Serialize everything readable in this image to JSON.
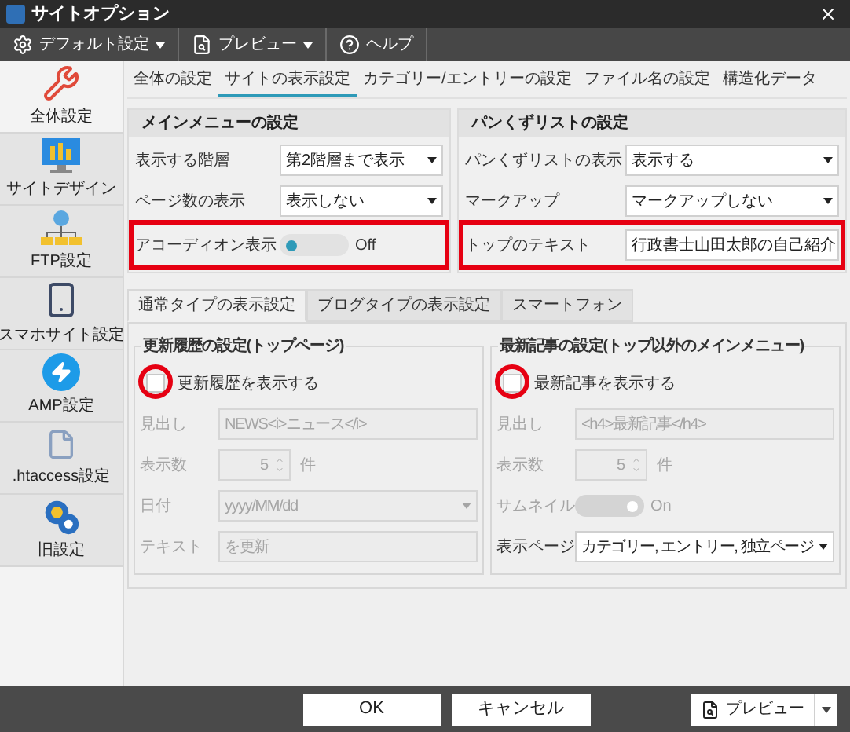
{
  "window": {
    "title": "サイトオプション"
  },
  "toolbar": [
    {
      "label": "デフォルト設定",
      "dropdown": true
    },
    {
      "label": "プレビュー",
      "dropdown": true
    },
    {
      "label": "ヘルプ",
      "dropdown": false
    }
  ],
  "sidebar": [
    {
      "label": "全体設定",
      "selected": true
    },
    {
      "label": "サイトデザイン",
      "selected": false
    },
    {
      "label": "FTP設定",
      "selected": false
    },
    {
      "label": "スマホサイト設定",
      "selected": false
    },
    {
      "label": "AMP設定",
      "selected": false
    },
    {
      "label": ".htaccess設定",
      "selected": false
    },
    {
      "label": "旧設定",
      "selected": false
    }
  ],
  "tabs": [
    {
      "label": "全体の設定",
      "selected": false
    },
    {
      "label": "サイトの表示設定",
      "selected": true
    },
    {
      "label": "カテゴリー/エントリーの設定",
      "selected": false
    },
    {
      "label": "ファイル名の設定",
      "selected": false
    },
    {
      "label": "構造化データ",
      "selected": false
    }
  ],
  "panels": [
    {
      "title": "メインメニューの設定",
      "rows": [
        {
          "kind": "select",
          "label": "表示する階層",
          "value": "第2階層まで表示",
          "highlight": false
        },
        {
          "kind": "select",
          "label": "ページ数の表示",
          "value": "表示しない",
          "highlight": false
        },
        {
          "kind": "toggle",
          "label": "アコーディオン表示",
          "on": false,
          "reading": "Off",
          "highlight": true
        }
      ]
    },
    {
      "title": "パンくずリストの設定",
      "rows": [
        {
          "kind": "select",
          "label": "パンくずリストの表示",
          "value": "表示する",
          "highlight": false
        },
        {
          "kind": "select",
          "label": "マークアップ",
          "value": "マークアップしない",
          "highlight": false
        },
        {
          "kind": "text",
          "label": "トップのテキスト",
          "value": "行政書士山田太郎の自己紹介",
          "highlight": true
        }
      ]
    }
  ],
  "inner_tabs": [
    {
      "label": "通常タイプの表示設定",
      "selected": true
    },
    {
      "label": "ブログタイプの表示設定",
      "selected": false
    },
    {
      "label": "スマートフォン",
      "selected": false
    }
  ],
  "groups": [
    {
      "title": "更新履歴の設定(トップページ)",
      "checkbox": {
        "label": "更新履歴を表示する",
        "checked": false,
        "circled": true
      },
      "rows": [
        {
          "kind": "text",
          "label": "見出し",
          "value": "NEWS<i>ニュース</i>",
          "disabled": true
        },
        {
          "kind": "spinner",
          "label": "表示数",
          "value": "5",
          "unit": "件",
          "disabled": true
        },
        {
          "kind": "select",
          "label": "日付",
          "value": "yyyy/MM/dd",
          "disabled": true
        },
        {
          "kind": "text",
          "label": "テキスト",
          "value": "を更新",
          "disabled": true
        }
      ]
    },
    {
      "title": "最新記事の設定(トップ以外のメインメニュー)",
      "checkbox": {
        "label": "最新記事を表示する",
        "checked": false,
        "circled": true
      },
      "rows": [
        {
          "kind": "text",
          "label": "見出し",
          "value": "<h4>最新記事</h4>",
          "disabled": true
        },
        {
          "kind": "spinner",
          "label": "表示数",
          "value": "5",
          "unit": "件",
          "disabled": true
        },
        {
          "kind": "toggle",
          "label": "サムネイル",
          "on": true,
          "reading": "On",
          "disabled": true
        },
        {
          "kind": "select",
          "label": "表示ページ",
          "value": "カテゴリー, エントリー, 独立ページ",
          "disabled": false
        }
      ]
    }
  ],
  "footer": {
    "buttons": [
      "OK",
      "キャンセル"
    ],
    "preview": "プレビュー"
  }
}
